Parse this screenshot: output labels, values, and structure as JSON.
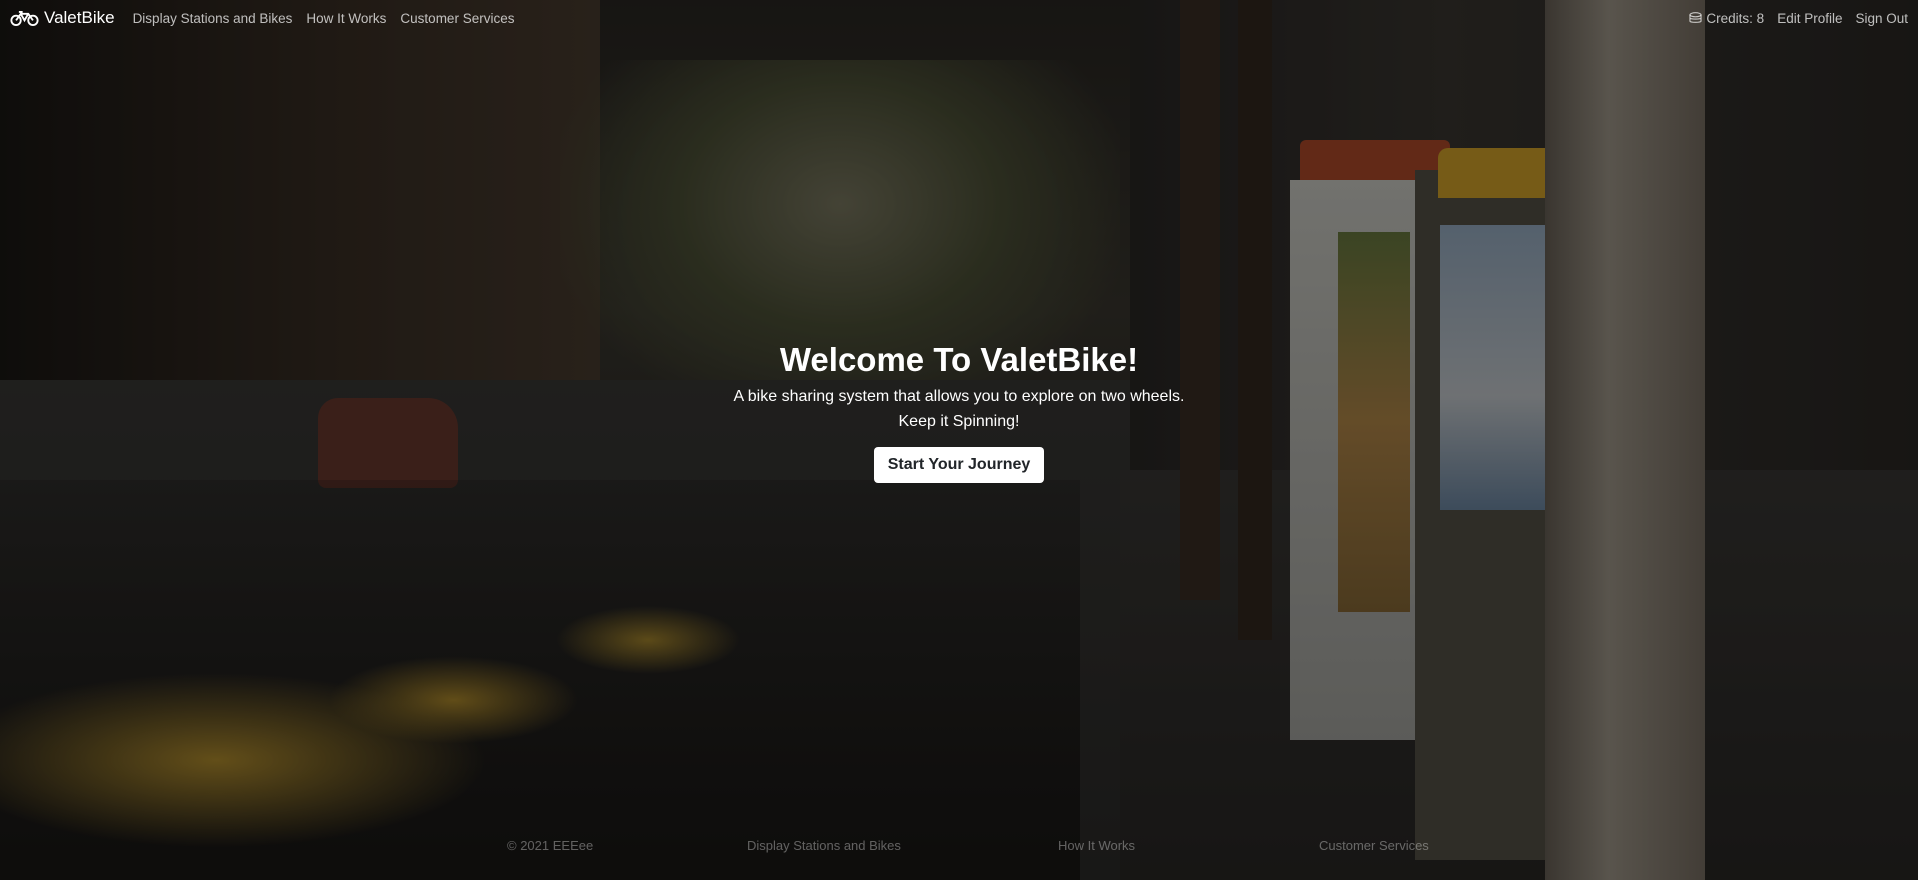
{
  "navbar": {
    "brand": "ValetBike",
    "brand_icon": "bicycle-icon",
    "links": [
      "Display Stations and Bikes",
      "How It Works",
      "Customer Services"
    ],
    "credits_icon": "coins-icon",
    "credits": "Credits: 8",
    "edit_profile": "Edit Profile",
    "sign_out": "Sign Out"
  },
  "hero": {
    "title": "Welcome To ValetBike!",
    "subtitle_line1": "A bike sharing system that allows you to explore on two wheels.",
    "subtitle_line2": "Keep it Spinning!",
    "cta": "Start Your Journey"
  },
  "footer": {
    "copyright": "© 2021 EEEee",
    "links": [
      "Display Stations and Bikes",
      "How It Works",
      "Customer Services"
    ]
  },
  "colors": {
    "overlay": "#000000",
    "button_bg": "#ffffff",
    "button_text": "#212529"
  }
}
